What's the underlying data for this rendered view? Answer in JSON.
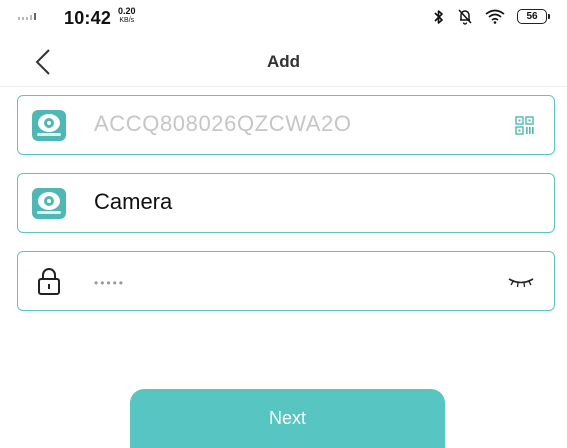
{
  "status_bar": {
    "time": "10:42",
    "net_speed_value": "0.20",
    "net_speed_unit": "KB/s",
    "battery": "56"
  },
  "header": {
    "title": "Add"
  },
  "form": {
    "device_id_value": "ACCQ808026QZCWA2O",
    "device_name_value": "Camera",
    "password_mask": "•••••"
  },
  "actions": {
    "next_label": "Next"
  },
  "icons": {
    "back": "back-arrow-icon",
    "camera": "camera-icon",
    "qr": "qr-code-icon",
    "lock": "lock-icon",
    "eye": "eye-closed-icon",
    "bluetooth": "bluetooth-icon",
    "silent": "bell-muted-icon",
    "wifi": "wifi-icon",
    "battery": "battery-icon"
  },
  "colors": {
    "accent": "#57c6c3",
    "field_border": "#5cc4c1",
    "placeholder_text": "#c6c6c6"
  }
}
